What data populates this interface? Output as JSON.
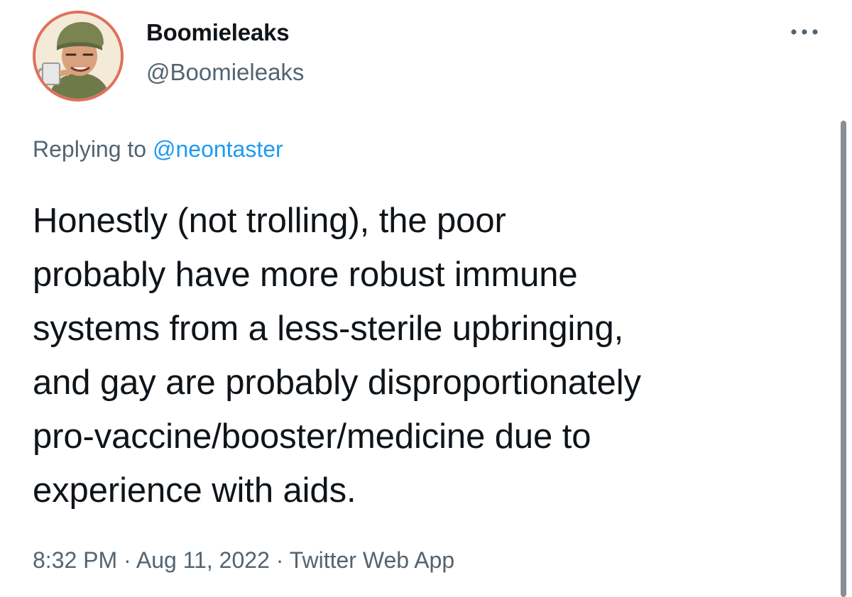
{
  "author": {
    "display_name": "Boomieleaks",
    "handle": "@Boomieleaks"
  },
  "more_icon": "more-horizontal-icon",
  "reply": {
    "prefix": "Replying to ",
    "handle": "@neontaster"
  },
  "tweet": {
    "text": "Honestly (not trolling), the poor\nprobably have more robust immune\nsystems from a less-sterile upbringing,\nand gay are probably disproportionately\npro-vaccine/booster/medicine due to\nexperience with aids."
  },
  "meta": {
    "time": "8:32 PM",
    "separator": " · ",
    "date": "Aug 11, 2022",
    "source": "Twitter Web App"
  },
  "colors": {
    "link": "#1d9bf0",
    "secondary_text": "#536471",
    "avatar_border": "#e0705a"
  }
}
